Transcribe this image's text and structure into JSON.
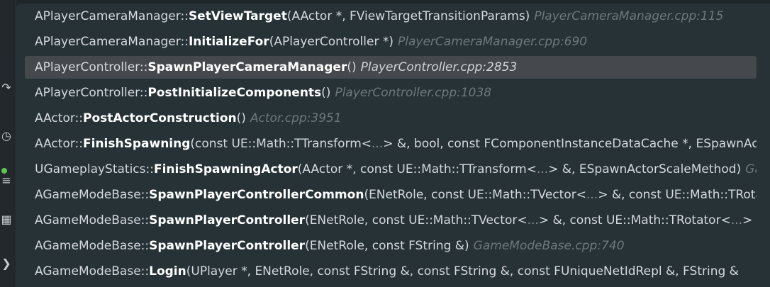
{
  "gutter": {
    "icons": [
      {
        "name": "run-icon",
        "glyph": "↷"
      },
      {
        "name": "debug-icon",
        "glyph": "◷"
      },
      {
        "name": "test-icon",
        "glyph": "≡"
      },
      {
        "name": "build-icon",
        "glyph": "▦"
      },
      {
        "name": "code-icon",
        "glyph": "❯"
      }
    ],
    "status_color": "#5fc34f"
  },
  "call_stack": {
    "frames": [
      {
        "class": "APlayerCameraManager",
        "separator": "::",
        "function": "SetViewTarget",
        "args": "(AActor *, FViewTargetTransitionParams)",
        "location": "PlayerCameraManager.cpp:115"
      },
      {
        "class": "APlayerCameraManager",
        "separator": "::",
        "function": "InitializeFor",
        "args": "(APlayerController *)",
        "location": "PlayerCameraManager.cpp:690"
      },
      {
        "class": "APlayerController",
        "separator": "::",
        "function": "SpawnPlayerCameraManager",
        "args": "()",
        "location": "PlayerController.cpp:2853"
      },
      {
        "class": "APlayerController",
        "separator": "::",
        "function": "PostInitializeComponents",
        "args": "()",
        "location": "PlayerController.cpp:1038"
      },
      {
        "class": "AActor",
        "separator": "::",
        "function": "PostActorConstruction",
        "args": "()",
        "location": "Actor.cpp:3951"
      },
      {
        "class": "AActor",
        "separator": "::",
        "function": "FinishSpawning",
        "args_a": "(const UE::Math::TTransform<",
        "ellipsis": "...",
        "args_b": "> &, bool, const FComponentInstanceDataCache *, ESpawnAc",
        "location": ""
      },
      {
        "class": "UGameplayStatics",
        "separator": "::",
        "function": "FinishSpawningActor",
        "args_a": "(AActor *, const UE::Math::TTransform<",
        "ellipsis": "...",
        "args_b": "> &, ESpawnActorScaleMethod)",
        "location": "Ga"
      },
      {
        "class": "AGameModeBase",
        "separator": "::",
        "function": "SpawnPlayerControllerCommon",
        "args_a": "(ENetRole, const UE::Math::TVector<",
        "ellipsis": "...",
        "args_b": "> &, const UE::Math::TRotat",
        "location": ""
      },
      {
        "class": "AGameModeBase",
        "separator": "::",
        "function": "SpawnPlayerController",
        "args_a": "(ENetRole, const UE::Math::TVector<",
        "ellipsis": "...",
        "args_b": "> &, const UE::Math::TRotator<",
        "ellipsis2": "...",
        "args_c": "> &",
        "location": ""
      },
      {
        "class": "AGameModeBase",
        "separator": "::",
        "function": "SpawnPlayerController",
        "args": "(ENetRole, const FString &)",
        "location": "GameModeBase.cpp:740"
      },
      {
        "class": "AGameModeBase",
        "separator": "::",
        "function": "Login",
        "args": "(UPlayer *, ENetRole, const FString &, const FString &, const FUniqueNetIdRepl &, FString &",
        "location": ""
      }
    ],
    "selected_index": 2
  }
}
